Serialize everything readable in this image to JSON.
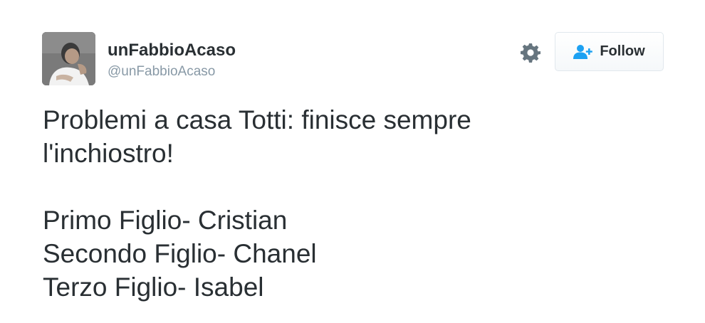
{
  "user": {
    "display_name": "unFabbioAcaso",
    "handle": "@unFabbioAcaso",
    "avatar_icon": "user-avatar-photo"
  },
  "actions": {
    "settings_icon": "gear-icon",
    "follow_icon": "add-user-icon",
    "follow_label": "Follow",
    "accent_color": "#1da1f2"
  },
  "tweet": {
    "lines": [
      "Problemi a casa Totti: finisce sempre",
      "l'inchiostro!",
      "",
      "Primo Figlio- Cristian",
      "Secondo Figlio- Chanel",
      "Terzo Figlio- Isabel"
    ]
  }
}
